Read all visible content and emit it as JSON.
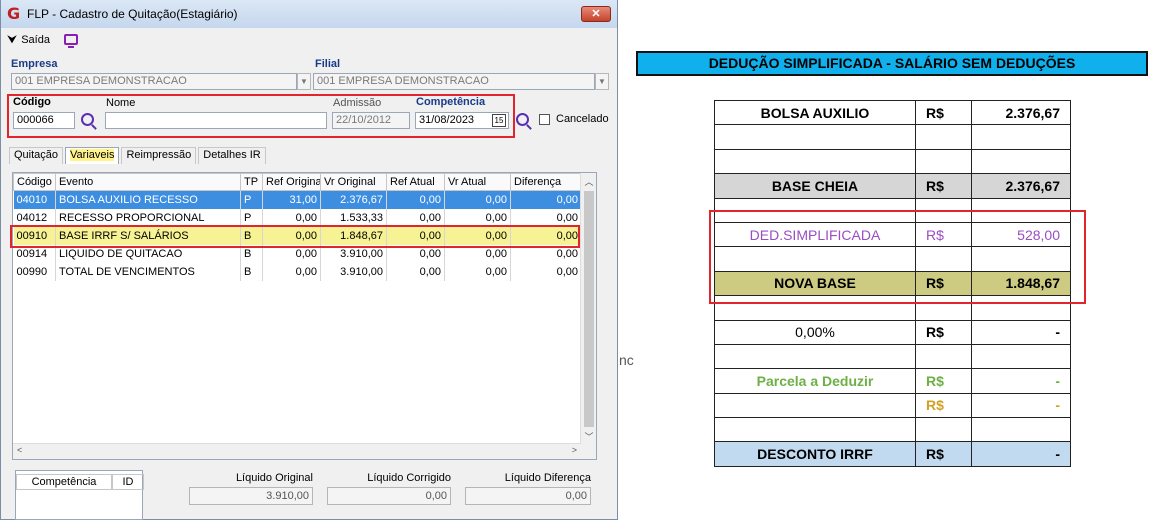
{
  "window": {
    "title": "FLP - Cadastro de Quitação(Estagiário)",
    "close_label": "✕",
    "toolbar": {
      "exit_label": "Saída"
    }
  },
  "form": {
    "empresa_label": "Empresa",
    "empresa_value": "001 EMPRESA DEMONSTRACAO",
    "filial_label": "Filial",
    "filial_value": "001 EMPRESA DEMONSTRACAO",
    "codigo_label": "Código",
    "codigo_value": "000066",
    "nome_label": "Nome",
    "nome_value": "",
    "admissao_label": "Admissão",
    "admissao_value": "22/10/2012",
    "competencia_label": "Competência",
    "competencia_value": "31/08/2023",
    "calendar_day": "15",
    "cancelado_label": "Cancelado"
  },
  "tabs": [
    {
      "label": "Quitação",
      "active": false
    },
    {
      "label": "Variaveis",
      "active": true
    },
    {
      "label": "Reimpressão",
      "active": false
    },
    {
      "label": "Detalhes IR",
      "active": false
    }
  ],
  "grid": {
    "columns": [
      "Código",
      "Evento",
      "TP",
      "Ref Original",
      "Vr Original",
      "Ref Atual",
      "Vr Atual",
      "Diferença"
    ],
    "rows": [
      [
        "04010",
        "BOLSA AUXILIO RECESSO",
        "P",
        "31,00",
        "2.376,67",
        "0,00",
        "0,00",
        "0,00"
      ],
      [
        "04012",
        "RECESSO PROPORCIONAL",
        "P",
        "0,00",
        "1.533,33",
        "0,00",
        "0,00",
        "0,00"
      ],
      [
        "00910",
        "BASE IRRF S/ SALÁRIOS",
        "B",
        "0,00",
        "1.848,67",
        "0,00",
        "0,00",
        "0,00"
      ],
      [
        "00914",
        "LIQUIDO DE QUITACAO",
        "B",
        "0,00",
        "3.910,00",
        "0,00",
        "0,00",
        "0,00"
      ],
      [
        "00990",
        "TOTAL DE VENCIMENTOS",
        "B",
        "0,00",
        "3.910,00",
        "0,00",
        "0,00",
        "0,00"
      ]
    ]
  },
  "footer": {
    "mini_cols": [
      "Competência",
      "ID"
    ],
    "liquido_original_label": "Líquido Original",
    "liquido_original_value": "3.910,00",
    "liquido_corrigido_label": "Líquido Corrigido",
    "liquido_corrigido_value": "0,00",
    "liquido_diferenca_label": "Líquido Diferença",
    "liquido_diferenca_value": "0,00"
  },
  "sheet": {
    "title": "DEDUÇÃO SIMPLIFICADA - SALÁRIO SEM DEDUÇÕES",
    "side_fragment": "nc",
    "rows": [
      {
        "label": "BOLSA AUXILIO",
        "currency": "R$",
        "value": "2.376,67"
      },
      {
        "label": "",
        "currency": "",
        "value": ""
      },
      {
        "label": "",
        "currency": "",
        "value": ""
      },
      {
        "label": "BASE CHEIA",
        "currency": "R$",
        "value": "2.376,67"
      },
      {
        "label": "",
        "currency": "",
        "value": ""
      },
      {
        "label": "DED.SIMPLIFICADA",
        "currency": "R$",
        "value": "528,00"
      },
      {
        "label": "",
        "currency": "",
        "value": ""
      },
      {
        "label": "NOVA BASE",
        "currency": "R$",
        "value": "1.848,67"
      },
      {
        "label": "",
        "currency": "",
        "value": ""
      },
      {
        "label": "0,00%",
        "currency": "R$",
        "value": "-"
      },
      {
        "label": "",
        "currency": "",
        "value": ""
      },
      {
        "label": "Parcela a Deduzir",
        "currency": "R$",
        "value": "-"
      },
      {
        "label": "",
        "currency": "R$",
        "value": "-"
      },
      {
        "label": "",
        "currency": "",
        "value": ""
      },
      {
        "label": "DESCONTO IRRF",
        "currency": "R$",
        "value": "-"
      }
    ]
  }
}
